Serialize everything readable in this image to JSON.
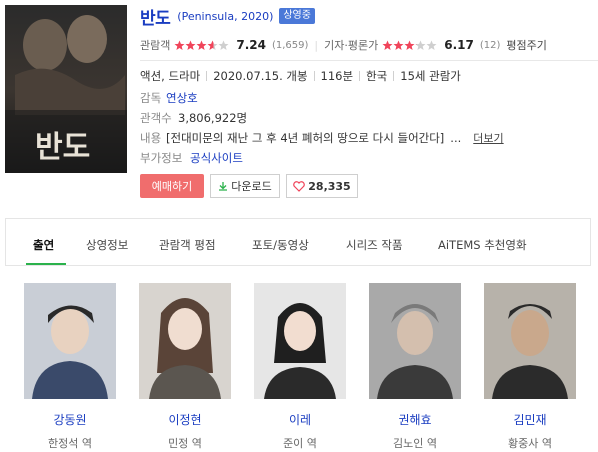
{
  "movie": {
    "title": "반도",
    "subtitle": "(Peninsula, 2020)",
    "badge": "상영중"
  },
  "ratings": {
    "audience_label": "관람객",
    "audience_score": "7.24",
    "audience_count": "(1,659)",
    "audience_stars": 3.6,
    "critic_label": "기자·평론가",
    "critic_score": "6.17",
    "critic_count": "(12)",
    "critic_stars": 3.1,
    "rate_link": "평점주기"
  },
  "meta": {
    "genre": "액션, 드라마",
    "release": "2020.07.15. 개봉",
    "runtime": "116분",
    "country": "한국",
    "age_rating": "15세 관람가"
  },
  "details": {
    "director_label": "감독",
    "director": "연상호",
    "audience_label": "관객수",
    "audience": "3,806,922명",
    "plot_label": "내용",
    "plot": "[전대미문의 재난 그 후 4년 폐허의 땅으로 다시 들어간다]",
    "plot_more": "...",
    "plot_more_link": "더보기",
    "extra_label": "부가정보",
    "extra_link": "공식사이트"
  },
  "buttons": {
    "book": "예매하기",
    "download": "다운로드",
    "likes": "28,335"
  },
  "tabs": [
    "출연",
    "상영정보",
    "관람객 평점",
    "포토/동영상",
    "시리즈 작품",
    "AiTEMS 추천영화"
  ],
  "cast": [
    {
      "name": "강동원",
      "role": "한정석 역"
    },
    {
      "name": "이정현",
      "role": "민정 역"
    },
    {
      "name": "이레",
      "role": "준이 역"
    },
    {
      "name": "권해효",
      "role": "김노인 역"
    },
    {
      "name": "김민재",
      "role": "황중사 역"
    }
  ],
  "colors": {
    "link": "#1a3dc1",
    "star": "#f0445a",
    "badge": "#4a78d8",
    "book_button": "#f06d6d",
    "tab_active": "#2bb24c"
  }
}
